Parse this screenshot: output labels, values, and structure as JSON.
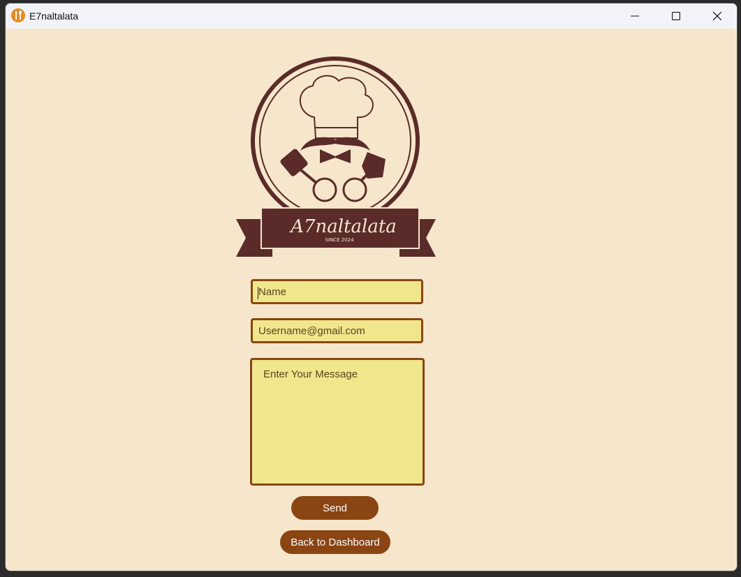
{
  "window": {
    "title": "E7naltalata",
    "controls": {
      "minimize": "minimize-icon",
      "maximize": "maximize-icon",
      "close": "close-icon"
    }
  },
  "logo": {
    "brand_text": "A7naltalata",
    "since_text": "SINCE 2024",
    "colors": {
      "maroon": "#5a2b28",
      "cream": "#f6e6cc"
    }
  },
  "form": {
    "name_placeholder": "Name",
    "email_placeholder": "Username@gmail.com",
    "message_placeholder": "Enter Your Message",
    "send_label": "Send",
    "back_label": "Back to Dashboard"
  },
  "colors": {
    "background": "#f6e6cc",
    "field_fill": "#f0e68c",
    "field_border": "#8b4513",
    "button": "#8b4513"
  }
}
